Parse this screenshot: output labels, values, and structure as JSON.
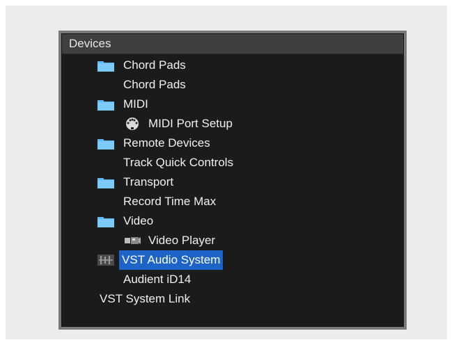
{
  "panel": {
    "title": "Devices"
  },
  "tree": [
    {
      "label": "Chord Pads",
      "icon": "folder-icon"
    },
    {
      "label": "Chord Pads",
      "icon": ""
    },
    {
      "label": "MIDI",
      "icon": "folder-icon"
    },
    {
      "label": "MIDI Port Setup",
      "icon": "midi-port-icon"
    },
    {
      "label": "Remote Devices",
      "icon": "folder-icon"
    },
    {
      "label": "Track Quick Controls",
      "icon": ""
    },
    {
      "label": "Transport",
      "icon": "folder-icon"
    },
    {
      "label": "Record Time Max",
      "icon": ""
    },
    {
      "label": "Video",
      "icon": "folder-icon"
    },
    {
      "label": "Video Player",
      "icon": "video-player-icon"
    },
    {
      "label": "VST Audio System",
      "icon": "audio-system-icon",
      "selected": true
    },
    {
      "label": "Audient iD14",
      "icon": ""
    },
    {
      "label": "VST System Link",
      "icon": ""
    }
  ],
  "colors": {
    "selection": "#1e64c8",
    "folder": "#5ab8ee",
    "panel_bg": "#1b1b1b"
  }
}
